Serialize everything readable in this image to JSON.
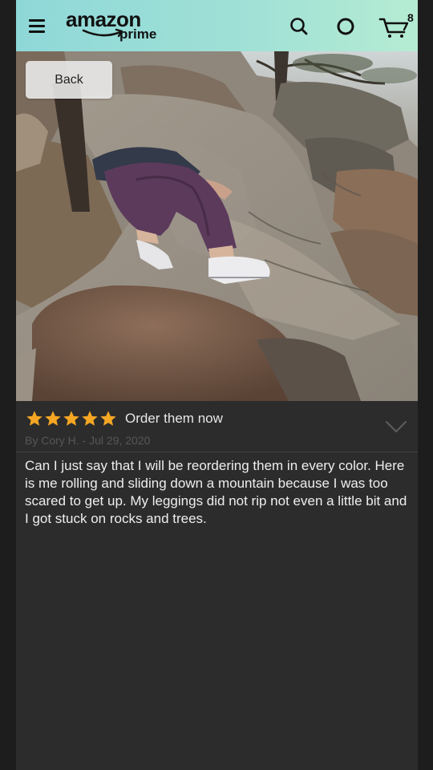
{
  "header": {
    "logo_word": "amazon",
    "logo_sub": "prime",
    "cart_count": "8",
    "icons": [
      "menu-icon",
      "search-icon",
      "alexa-icon",
      "cart-icon"
    ],
    "bg_colors": [
      "#8fd8d8",
      "#b5ecd3"
    ]
  },
  "photo": {
    "back_label": "Back"
  },
  "review": {
    "stars": 5,
    "star_color": "#f5a623",
    "title": "Order them now",
    "byline": "By Cory H. - Jul 29, 2020",
    "body": "Can I just say that I will be reordering them in every color. Here is me rolling and sliding down a mountain because I was too scared to get up. My leggings did not rip not even a little bit and I got stuck on rocks and trees."
  }
}
